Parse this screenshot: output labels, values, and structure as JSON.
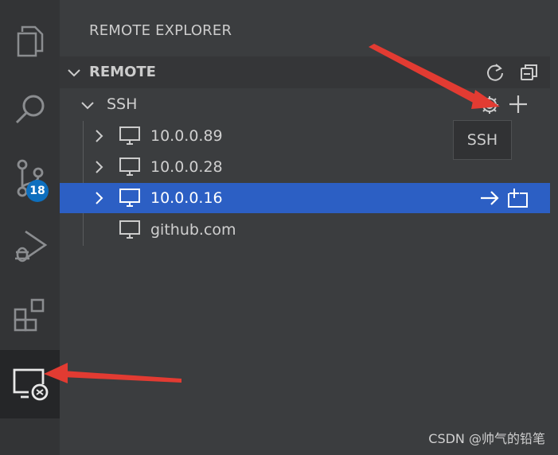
{
  "activity_bar": {
    "items": [
      {
        "name": "explorer-icon"
      },
      {
        "name": "search-icon"
      },
      {
        "name": "source-control-icon",
        "badge": "18"
      },
      {
        "name": "run-debug-icon"
      },
      {
        "name": "extensions-icon"
      },
      {
        "name": "remote-explorer-icon",
        "active": true
      }
    ]
  },
  "sidebar": {
    "title": "REMOTE EXPLORER",
    "section": {
      "label": "REMOTE",
      "actions": [
        "refresh-icon",
        "collapse-all-icon"
      ]
    },
    "group": {
      "label": "SSH",
      "actions": [
        "gear-icon",
        "plus-icon"
      ],
      "tooltip": "SSH"
    },
    "hosts": [
      {
        "label": "10.0.0.89",
        "expandable": true,
        "selected": false
      },
      {
        "label": "10.0.0.28",
        "expandable": true,
        "selected": false
      },
      {
        "label": "10.0.0.16",
        "expandable": true,
        "selected": true,
        "actions": [
          "connect-arrow-icon",
          "open-new-window-icon"
        ]
      },
      {
        "label": "github.com",
        "expandable": false,
        "selected": false
      }
    ]
  },
  "colors": {
    "selection": "#2c5fc4",
    "badge": "#0e6fbe",
    "annotation_arrow": "#e23b32"
  },
  "watermark": "CSDN @帅气的铅笔"
}
